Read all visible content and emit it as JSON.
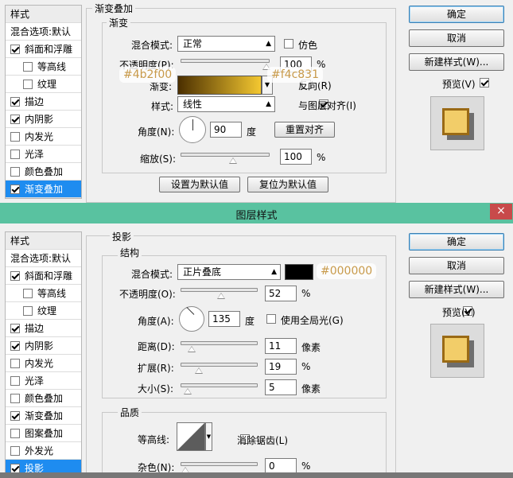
{
  "top_dialog": {
    "left_header": "样式",
    "left_items": [
      {
        "label": "混合选项:默认",
        "checkbox": false,
        "checked": false,
        "indent": false,
        "selected": false
      },
      {
        "label": "斜面和浮雕",
        "checkbox": true,
        "checked": true,
        "indent": false,
        "selected": false
      },
      {
        "label": "等高线",
        "checkbox": true,
        "checked": false,
        "indent": true,
        "selected": false
      },
      {
        "label": "纹理",
        "checkbox": true,
        "checked": false,
        "indent": true,
        "selected": false
      },
      {
        "label": "描边",
        "checkbox": true,
        "checked": true,
        "indent": false,
        "selected": false
      },
      {
        "label": "内阴影",
        "checkbox": true,
        "checked": true,
        "indent": false,
        "selected": false
      },
      {
        "label": "内发光",
        "checkbox": true,
        "checked": false,
        "indent": false,
        "selected": false
      },
      {
        "label": "光泽",
        "checkbox": true,
        "checked": false,
        "indent": false,
        "selected": false
      },
      {
        "label": "颜色叠加",
        "checkbox": true,
        "checked": false,
        "indent": false,
        "selected": false
      },
      {
        "label": "渐变叠加",
        "checkbox": true,
        "checked": true,
        "indent": false,
        "selected": true
      }
    ],
    "panel_title": "渐变叠加",
    "group_title": "渐变",
    "blend_mode_label": "混合模式:",
    "blend_mode_value": "正常",
    "dither_label": "仿色",
    "opacity_label": "不透明度(P):",
    "opacity_value": "100",
    "opacity_unit": "%",
    "gradient_label": "渐变:",
    "reverse_label": "反向(R)",
    "style_label": "样式:",
    "style_value": "线性",
    "align_label": "与图层对齐(I)",
    "angle_label": "角度(N):",
    "angle_value": "90",
    "angle_unit": "度",
    "reset_align_button": "重置对齐",
    "scale_label": "缩放(S):",
    "scale_value": "100",
    "scale_unit": "%",
    "set_default_button": "设置为默认值",
    "reset_default_button": "复位为默认值",
    "ok_button": "确定",
    "cancel_button": "取消",
    "new_style_button": "新建样式(W)...",
    "preview_label": "预览(V)",
    "annotation_left": "#4b2f00",
    "annotation_right": "#f4c831",
    "gradient_colors": [
      "#4b2f00",
      "#f4c831"
    ],
    "opacity_fraction": 1.0,
    "scale_fraction": 0.59
  },
  "titlebar": {
    "title": "图层样式",
    "close": "×"
  },
  "bottom_dialog": {
    "left_header": "样式",
    "left_items": [
      {
        "label": "混合选项:默认",
        "checkbox": false,
        "checked": false,
        "indent": false,
        "selected": false
      },
      {
        "label": "斜面和浮雕",
        "checkbox": true,
        "checked": true,
        "indent": false,
        "selected": false
      },
      {
        "label": "等高线",
        "checkbox": true,
        "checked": false,
        "indent": true,
        "selected": false
      },
      {
        "label": "纹理",
        "checkbox": true,
        "checked": false,
        "indent": true,
        "selected": false
      },
      {
        "label": "描边",
        "checkbox": true,
        "checked": true,
        "indent": false,
        "selected": false
      },
      {
        "label": "内阴影",
        "checkbox": true,
        "checked": true,
        "indent": false,
        "selected": false
      },
      {
        "label": "内发光",
        "checkbox": true,
        "checked": false,
        "indent": false,
        "selected": false
      },
      {
        "label": "光泽",
        "checkbox": true,
        "checked": false,
        "indent": false,
        "selected": false
      },
      {
        "label": "颜色叠加",
        "checkbox": true,
        "checked": false,
        "indent": false,
        "selected": false
      },
      {
        "label": "渐变叠加",
        "checkbox": true,
        "checked": true,
        "indent": false,
        "selected": false
      },
      {
        "label": "图案叠加",
        "checkbox": true,
        "checked": false,
        "indent": false,
        "selected": false
      },
      {
        "label": "外发光",
        "checkbox": true,
        "checked": false,
        "indent": false,
        "selected": false
      },
      {
        "label": "投影",
        "checkbox": true,
        "checked": true,
        "indent": false,
        "selected": true
      }
    ],
    "panel_title": "投影",
    "group_title": "结构",
    "blend_mode_label": "混合模式:",
    "blend_mode_value": "正片叠底",
    "shadow_color": "#000000",
    "annotation": "#000000",
    "opacity_label": "不透明度(O):",
    "opacity_value": "52",
    "opacity_unit": "%",
    "angle_label": "角度(A):",
    "angle_value": "135",
    "angle_unit": "度",
    "global_light_label": "使用全局光(G)",
    "distance_label": "距离(D):",
    "distance_value": "11",
    "distance_unit": "像素",
    "spread_label": "扩展(R):",
    "spread_value": "19",
    "spread_unit": "%",
    "size_label": "大小(S):",
    "size_value": "5",
    "size_unit": "像素",
    "quality_title": "品质",
    "contour_label": "等高线:",
    "antialias_label": "消除锯齿(L)",
    "noise_label": "杂色(N):",
    "noise_value": "0",
    "noise_unit": "%",
    "ok_button": "确定",
    "cancel_button": "取消",
    "new_style_button": "新建样式(W)...",
    "preview_label": "预览(V)",
    "opacity_fraction": 0.52,
    "distance_fraction": 0.09,
    "spread_fraction": 0.19,
    "size_fraction": 0.04,
    "noise_fraction": 0.0
  },
  "colors": {
    "titlebar": "#59c2a0",
    "selection": "#1e8cf0",
    "annotation_text": "#c89a4a"
  }
}
